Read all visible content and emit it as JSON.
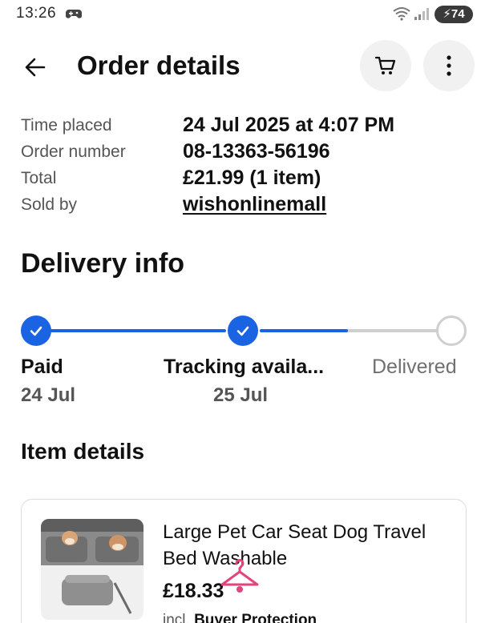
{
  "status_bar": {
    "time": "13:26",
    "battery": "74",
    "app_icon": "gamepad-icon"
  },
  "header": {
    "title": "Order details",
    "icons": [
      "back-arrow-icon",
      "cart-icon",
      "more-vertical-icon"
    ]
  },
  "summary": {
    "rows": [
      {
        "label": "Time placed",
        "value": "24 Jul 2025 at 4:07 PM"
      },
      {
        "label": "Order number",
        "value": "08-13363-56196"
      },
      {
        "label": "Total",
        "value": "£21.99 (1 item)"
      },
      {
        "label": "Sold by",
        "value": "wishonlinemall"
      }
    ]
  },
  "delivery": {
    "title": "Delivery info",
    "steps": [
      {
        "name": "Paid",
        "date": "24 Jul",
        "status": "complete"
      },
      {
        "name": "Tracking availa...",
        "date": "25 Jul",
        "status": "complete"
      },
      {
        "name": "Delivered",
        "date": "",
        "status": "pending"
      }
    ],
    "progress_between_step_2_and_3": 0.5,
    "accent_color": "#1a64e3",
    "inactive_color": "#cfcfcf"
  },
  "items": {
    "title": "Item details",
    "list": [
      {
        "name": "Large Pet Car Seat Dog Travel Bed Washable",
        "price": "£18.33",
        "note_prefix": "incl.",
        "note_emphasis": "Buyer Protection"
      }
    ]
  }
}
